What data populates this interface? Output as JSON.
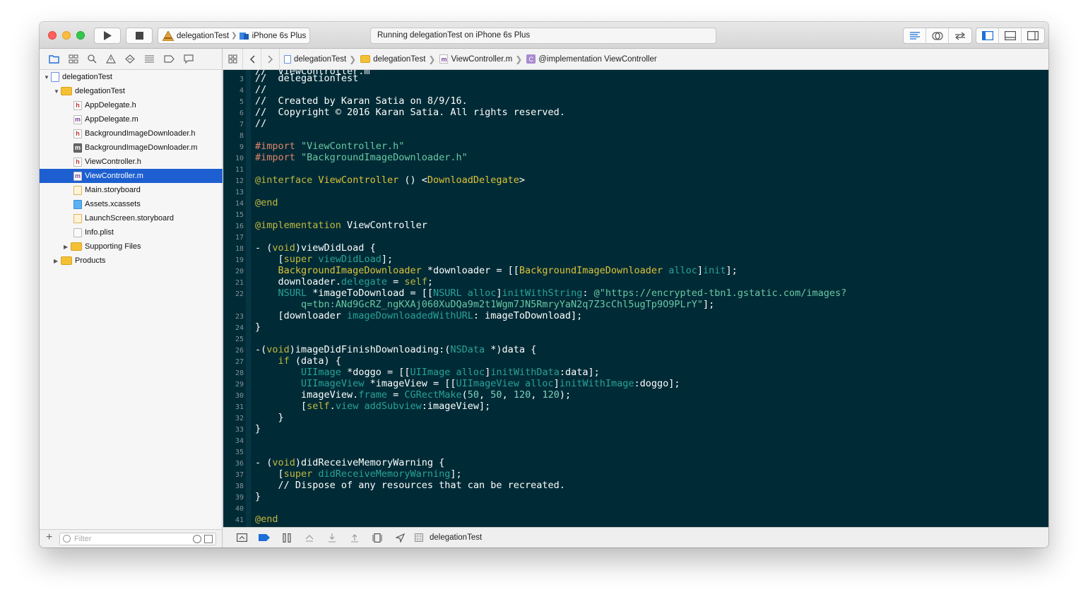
{
  "toolbar": {
    "scheme_app": "delegationTest",
    "scheme_device": "iPhone 6s Plus",
    "status": "Running delegationTest on iPhone 6s Plus"
  },
  "jumpbar": {
    "crumbs": [
      "delegationTest",
      "delegationTest",
      "ViewController.m",
      "@implementation ViewController"
    ]
  },
  "navigator": {
    "project": "delegationTest",
    "group": "delegationTest",
    "files": [
      {
        "name": "AppDelegate.h",
        "type": "h"
      },
      {
        "name": "AppDelegate.m",
        "type": "m"
      },
      {
        "name": "BackgroundImageDownloader.h",
        "type": "h"
      },
      {
        "name": "BackgroundImageDownloader.m",
        "type": "m"
      },
      {
        "name": "ViewController.h",
        "type": "h"
      },
      {
        "name": "ViewController.m",
        "type": "m",
        "selected": true
      },
      {
        "name": "Main.storyboard",
        "type": "storyboard"
      },
      {
        "name": "Assets.xcassets",
        "type": "assets"
      },
      {
        "name": "LaunchScreen.storyboard",
        "type": "storyboard"
      },
      {
        "name": "Info.plist",
        "type": "plist"
      }
    ],
    "supporting_files": "Supporting Files",
    "products": "Products",
    "filter_placeholder": "Filter"
  },
  "editor": {
    "line_numbers": [
      "3",
      "4",
      "5",
      "6",
      "7",
      "8",
      "9",
      "10",
      "11",
      "12",
      "13",
      "14",
      "15",
      "16",
      "17",
      "18",
      "19",
      "20",
      "21",
      "22",
      "",
      "23",
      "24",
      "25",
      "26",
      "27",
      "28",
      "29",
      "30",
      "31",
      "32",
      "33",
      "34",
      "35",
      "36",
      "37",
      "38",
      "39",
      "40",
      "41"
    ]
  },
  "debugbar": {
    "target": "delegationTest"
  },
  "colors": {
    "editor_bg": "#002b36",
    "selection": "#1d5fd1"
  }
}
